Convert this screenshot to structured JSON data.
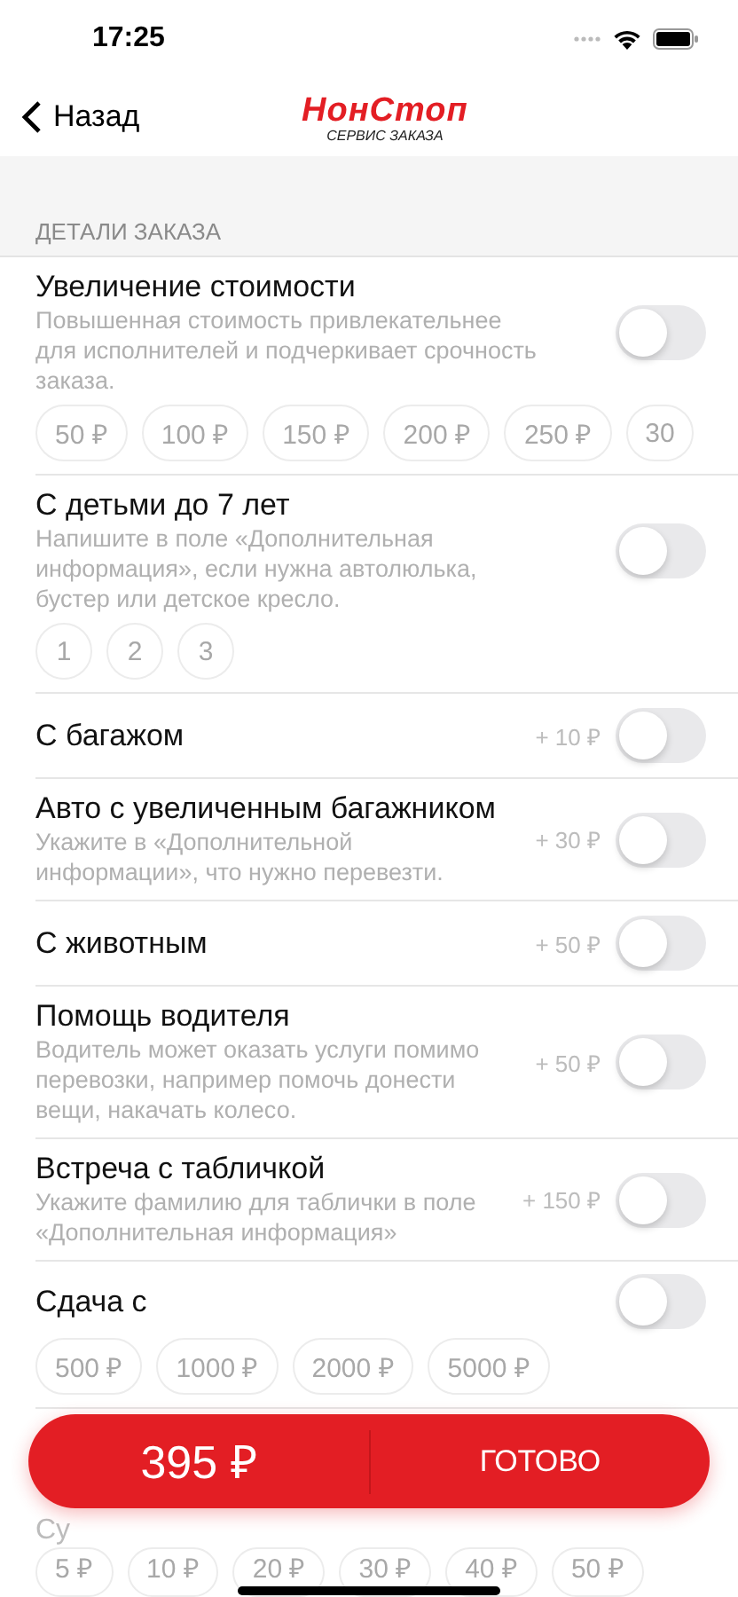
{
  "status_bar": {
    "time": "17:25"
  },
  "nav": {
    "back": "Назад",
    "logo_name": "НонСтоп",
    "logo_tagline": "СЕРВИС ЗАКАЗА"
  },
  "section": {
    "title": "ДЕТАЛИ ЗАКАЗА"
  },
  "options": [
    {
      "title": "Увеличение стоимости",
      "description": "Повышенная стоимость привлекательнее для исполнителей и подчеркивает срочность заказа.",
      "on": false,
      "chips": [
        {
          "label": "50 ₽",
          "selected": false
        },
        {
          "label": "100 ₽",
          "selected": false
        },
        {
          "label": "150 ₽",
          "selected": false
        },
        {
          "label": "200 ₽",
          "selected": false
        },
        {
          "label": "250 ₽",
          "selected": false
        },
        {
          "label": "30",
          "selected": false
        }
      ]
    },
    {
      "title": "С детьми до 7 лет",
      "description": "Напишите в поле «Дополнительная информация», если нужна автолюлька, бустер или детское кресло.",
      "on": false,
      "chips": [
        {
          "label": "1",
          "selected": false
        },
        {
          "label": "2",
          "selected": false
        },
        {
          "label": "3",
          "selected": false
        }
      ]
    },
    {
      "title": "С багажом",
      "price": "+ 10 ₽",
      "on": false
    },
    {
      "title": "Авто с увеличенным багажником",
      "description": "Укажите в «Дополнительной информации», что нужно перевезти.",
      "price": "+ 30 ₽",
      "on": false
    },
    {
      "title": "С животным",
      "price": "+ 50 ₽",
      "on": false
    },
    {
      "title": "Помощь водителя",
      "description": "Водитель может оказать услуги помимо перевозки, например помочь донести вещи, накачать колесо.",
      "price": "+ 50 ₽",
      "on": false
    },
    {
      "title": "Встреча с табличкой",
      "description": "Укажите фамилию для таблички в поле «Дополнительная информация»",
      "price": "+ 150 ₽",
      "on": false
    },
    {
      "title": "Сдача с",
      "on": false,
      "chips": [
        {
          "label": "500 ₽",
          "selected": false
        },
        {
          "label": "1000 ₽",
          "selected": false
        },
        {
          "label": "2000 ₽",
          "selected": false
        },
        {
          "label": "5000 ₽",
          "selected": false
        }
      ]
    }
  ],
  "partial_row": {
    "title": "Су",
    "chips": [
      {
        "label": "5 ₽",
        "selected": false
      },
      {
        "label": "10 ₽",
        "selected": false
      },
      {
        "label": "20 ₽",
        "selected": false
      },
      {
        "label": "30 ₽",
        "selected": false
      },
      {
        "label": "40 ₽",
        "selected": false
      },
      {
        "label": "50 ₽",
        "selected": false
      }
    ]
  },
  "order_button": {
    "total": "395 ₽",
    "action": "ГОТОВО"
  }
}
